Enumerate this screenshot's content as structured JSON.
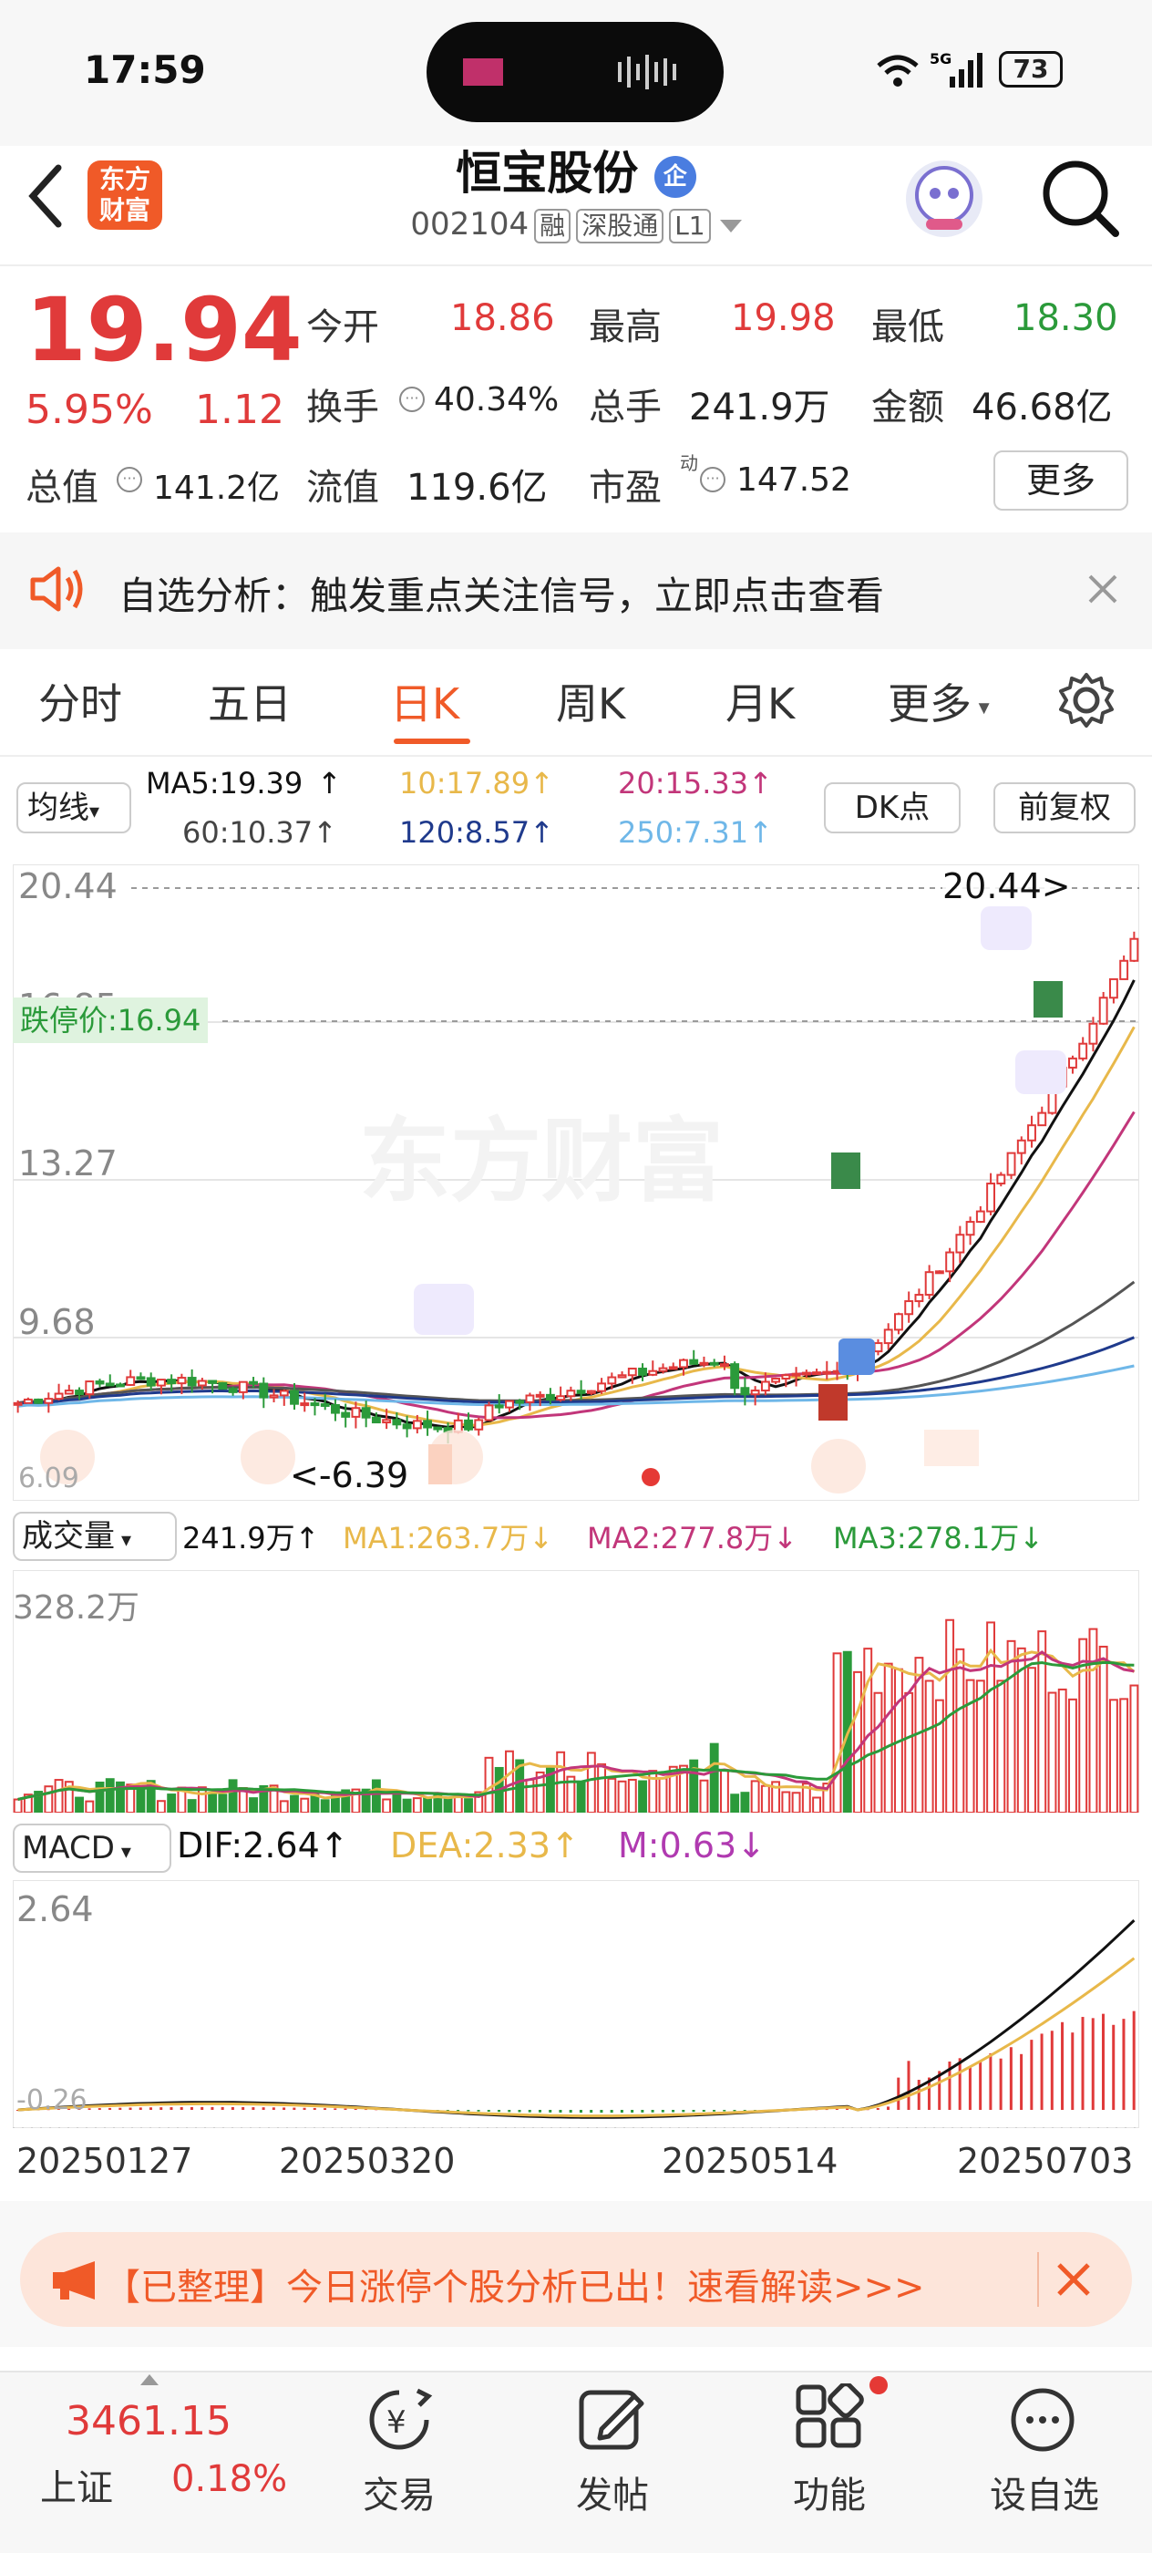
{
  "status_bar": {
    "time": "17:59",
    "battery": "73"
  },
  "header": {
    "title": "恒宝股份",
    "badge": "企",
    "code": "002104",
    "tags": [
      "融",
      "深股通",
      "L1"
    ],
    "logo": "东方财富"
  },
  "quote": {
    "price": "19.94",
    "change_pct": "5.95%",
    "change": "1.12",
    "open_label": "今开",
    "open": "18.86",
    "high_label": "最高",
    "high": "19.98",
    "low_label": "最低",
    "low": "18.30",
    "turnover_label": "换手",
    "turnover": "40.34%",
    "volume_label": "总手",
    "volume": "241.9万",
    "amount_label": "金额",
    "amount": "46.68亿",
    "mktcap_label": "总值",
    "mktcap": "141.2亿",
    "float_label": "流值",
    "float_cap": "119.6亿",
    "pe_label": "市盈",
    "pe_sup": "动",
    "pe": "147.52",
    "more_label": "更多"
  },
  "notice": {
    "text": "自选分析：触发重点关注信号，立即点击查看"
  },
  "tabs": [
    {
      "label": "分时"
    },
    {
      "label": "五日"
    },
    {
      "label": "日K",
      "active": true
    },
    {
      "label": "周K"
    },
    {
      "label": "月K"
    },
    {
      "label": "更多"
    }
  ],
  "ma_legend": {
    "select": "均线",
    "ma5": "MA5:19.39",
    "ma10": "10:17.89",
    "ma20": "20:15.33",
    "ma60": "60:10.37",
    "ma120": "120:8.57",
    "ma250": "250:7.31",
    "dk": "DK点",
    "fq": "前复权"
  },
  "price_axis": {
    "top": "20.44",
    "mid1": "16.85",
    "mid2": "13.27",
    "mid3": "9.68",
    "bottom": "6.09",
    "limit_down_label": "跌停价:16.94",
    "high_flag": "20.44>",
    "low_flag": "<-6.39",
    "watermark": "东方财富"
  },
  "volume_legend": {
    "select": "成交量",
    "value": "241.9万",
    "ma1": "MA1:263.7万",
    "ma2": "MA2:277.8万",
    "ma3": "MA3:278.1万",
    "axis_top": "328.2万"
  },
  "macd_legend": {
    "select": "MACD",
    "dif": "DIF:2.64",
    "dea": "DEA:2.33",
    "m": "M:0.63",
    "axis_top": "2.64",
    "axis_bottom": "-0.26"
  },
  "dates": [
    "20250127",
    "20250320",
    "20250514",
    "20250703"
  ],
  "banner": {
    "text": "【已整理】今日涨停个股分析已出！速看解读>>>"
  },
  "bottom_nav": {
    "index_value": "3461.15",
    "index_name": "上证",
    "index_change": "0.18%",
    "items": [
      {
        "label": "交易"
      },
      {
        "label": "发帖"
      },
      {
        "label": "功能"
      },
      {
        "label": "设自选"
      }
    ]
  },
  "colors": {
    "up": "#e03a3a",
    "down": "#2b9a3a",
    "accent": "#f05a28",
    "ma5": "#111111",
    "ma10": "#e8b84a",
    "ma20": "#c2367a",
    "ma60": "#555555",
    "ma120": "#1f3a8c",
    "ma250": "#6fb7e8"
  }
}
